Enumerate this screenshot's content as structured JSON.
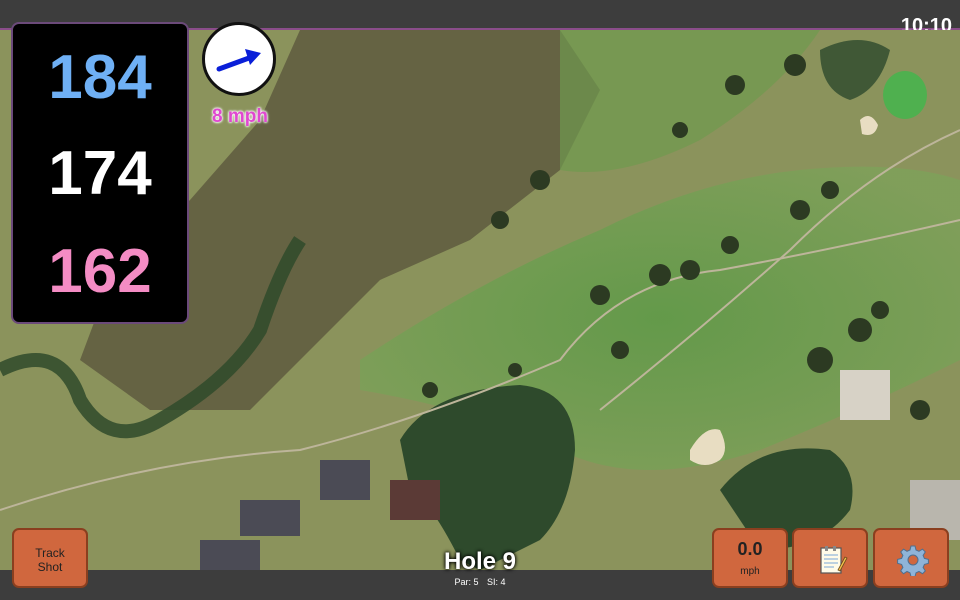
{
  "status": {
    "time": "10:10"
  },
  "distances": {
    "back": "184",
    "center": "174",
    "front": "162"
  },
  "wind": {
    "speed_label": "8 mph",
    "direction_icon": "wind-arrow-icon",
    "arrow_color": "#0a1fd8"
  },
  "hole": {
    "title": "Hole 9",
    "par_label": "Par: 5",
    "si_label": "SI: 4"
  },
  "controls": {
    "track_shot_line1": "Track",
    "track_shot_line2": "Shot",
    "speed_value": "0.0",
    "speed_unit": "mph",
    "notes_icon": "notepad-icon",
    "settings_icon": "gear-icon"
  },
  "colors": {
    "back_distance": "#6fb0f5",
    "center_distance": "#ffffff",
    "front_distance": "#f48cc4",
    "button_bg": "#d0673e",
    "wind_text": "#e048d0"
  }
}
